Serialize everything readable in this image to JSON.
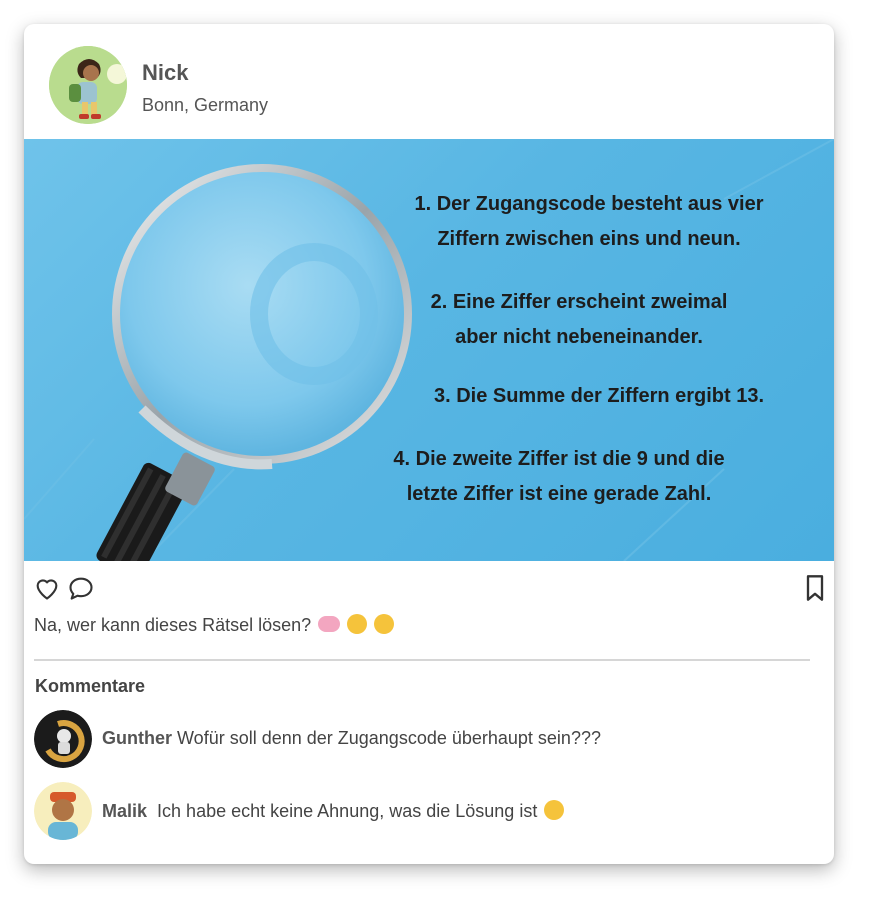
{
  "post": {
    "user_name": "Nick",
    "location": "Bonn, Germany",
    "riddle": {
      "line1a": "1. Der Zugangscode besteht aus vier",
      "line1b": "Ziffern zwischen eins und neun.",
      "line2a": "2. Eine Ziffer erscheint zweimal",
      "line2b": "aber nicht nebeneinander.",
      "line3": "3. Die Summe der Ziffern ergibt 13.",
      "line4a": "4. Die zweite Ziffer ist die 9 und die",
      "line4b": "letzte Ziffer ist eine gerade Zahl."
    },
    "caption": "Na, wer kann dieses Rätsel lösen?",
    "caption_emojis": [
      "brain-emoji",
      "monocle-face-emoji",
      "nerd-face-emoji"
    ]
  },
  "actions": {
    "icons": [
      "heart-icon",
      "comment-icon",
      "bookmark-icon"
    ]
  },
  "comments": {
    "title": "Kommentare",
    "items": [
      {
        "author": "Gunther",
        "text": "Wofür soll denn der Zugangscode überhaupt sein???"
      },
      {
        "author": "Malik",
        "text": "Ich habe echt keine Ahnung, was die Lösung ist",
        "emoji": "smiling-face-with-heart-eyes-emoji"
      }
    ]
  },
  "colors": {
    "image_background": "#58b6e3",
    "text": "#444444",
    "divider": "#d6d6d6"
  }
}
